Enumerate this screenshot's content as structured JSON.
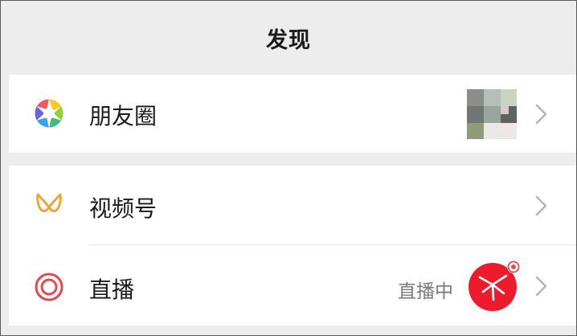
{
  "header": {
    "title": "发现"
  },
  "items": [
    {
      "label": "朋友圈",
      "icon": "moments-aperture-icon"
    },
    {
      "label": "视频号",
      "icon": "channels-butterfly-icon"
    },
    {
      "label": "直播",
      "icon": "live-circle-icon",
      "status_text": "直播中"
    }
  ],
  "colors": {
    "background": "#ededed",
    "card": "#ffffff",
    "channels_orange": "#f0a23c",
    "live_red": "#e5484d",
    "live_avatar_red": "#ec1c2e",
    "secondary_text": "#7a7a7a"
  }
}
